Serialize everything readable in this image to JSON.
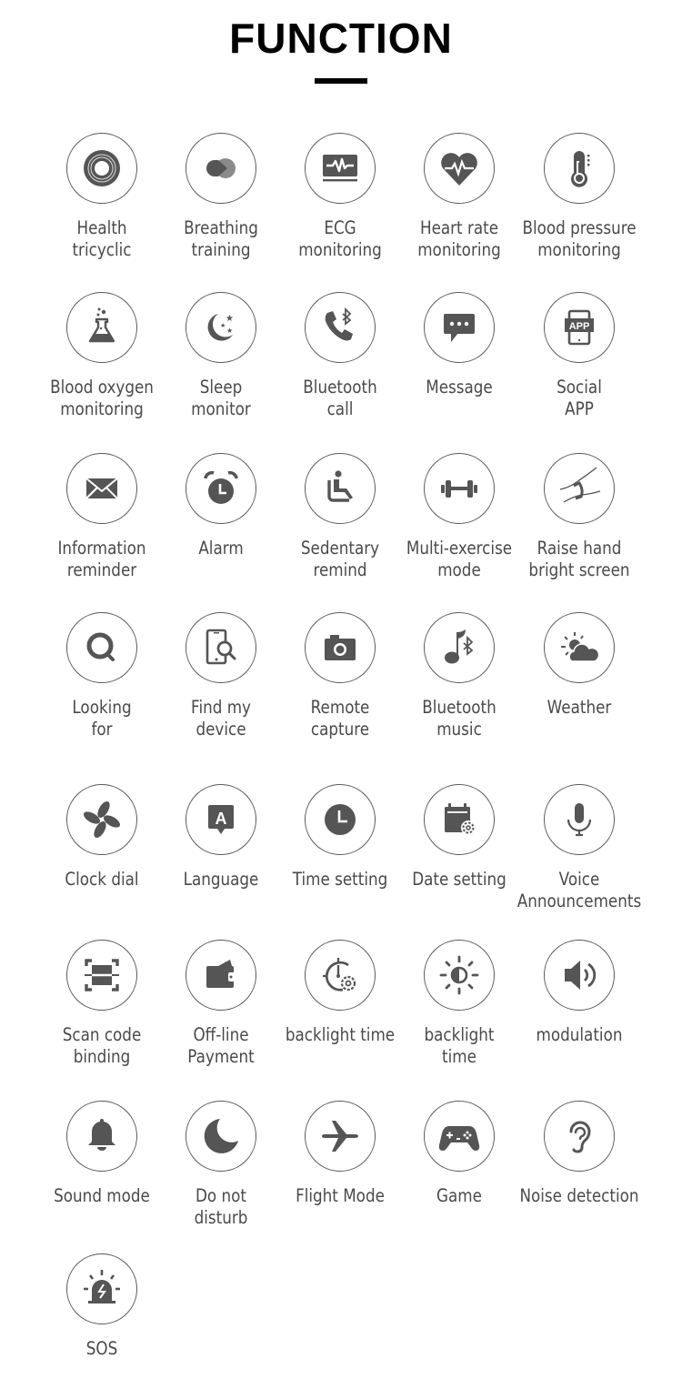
{
  "header": {
    "title": "FUNCTION"
  },
  "icon_color": "#555555",
  "features": [
    {
      "id": "health-tricyclic",
      "icon": "concentric-rings-icon",
      "lines": [
        "Health",
        "tricyclic"
      ]
    },
    {
      "id": "breathing-training",
      "icon": "breathing-drops-icon",
      "lines": [
        "Breathing",
        "training"
      ]
    },
    {
      "id": "ecg-monitoring",
      "icon": "ecg-monitor-icon",
      "lines": [
        "ECG",
        "monitoring"
      ]
    },
    {
      "id": "heart-rate-monitoring",
      "icon": "heart-pulse-icon",
      "lines": [
        "Heart rate",
        "monitoring"
      ]
    },
    {
      "id": "blood-pressure-monitoring",
      "icon": "thermometer-icon",
      "lines": [
        "Blood pressure",
        "monitoring"
      ]
    },
    {
      "id": "blood-oxygen-monitoring",
      "icon": "flask-icon",
      "lines": [
        "Blood oxygen",
        "monitoring"
      ]
    },
    {
      "id": "sleep-monitor",
      "icon": "moon-stars-icon",
      "lines": [
        "Sleep",
        "monitor"
      ]
    },
    {
      "id": "bluetooth-call",
      "icon": "phone-bluetooth-icon",
      "lines": [
        "Bluetooth",
        "call"
      ]
    },
    {
      "id": "message",
      "icon": "chat-bubble-icon",
      "lines": [
        "Message"
      ]
    },
    {
      "id": "social-app",
      "icon": "app-tablet-icon",
      "lines": [
        "Social",
        "APP"
      ]
    },
    {
      "id": "information-reminder",
      "icon": "envelope-icon",
      "lines": [
        "Information",
        "reminder"
      ]
    },
    {
      "id": "alarm",
      "icon": "alarm-clock-icon",
      "lines": [
        "Alarm"
      ]
    },
    {
      "id": "sedentary-remind",
      "icon": "seated-person-icon",
      "lines": [
        "Sedentary",
        "remind"
      ]
    },
    {
      "id": "multi-exercise-mode",
      "icon": "dumbbell-icon",
      "lines": [
        "Multi-exercise",
        "mode"
      ]
    },
    {
      "id": "raise-hand-bright-screen",
      "icon": "wrist-band-icon",
      "lines": [
        "Raise hand",
        "bright screen"
      ]
    },
    {
      "id": "looking-for",
      "icon": "search-icon",
      "lines": [
        "Looking",
        "for"
      ]
    },
    {
      "id": "find-my-device",
      "icon": "phone-search-icon",
      "lines": [
        "Find my",
        "device"
      ]
    },
    {
      "id": "remote-capture",
      "icon": "camera-icon",
      "lines": [
        "Remote",
        "capture"
      ]
    },
    {
      "id": "bluetooth-music",
      "icon": "music-bluetooth-icon",
      "lines": [
        "Bluetooth",
        "music"
      ]
    },
    {
      "id": "weather",
      "icon": "sun-cloud-icon",
      "lines": [
        "Weather"
      ]
    },
    {
      "id": "clock-dial",
      "icon": "pinwheel-icon",
      "lines": [
        "Clock dial"
      ]
    },
    {
      "id": "language",
      "icon": "language-bubble-icon",
      "lines": [
        "Language"
      ]
    },
    {
      "id": "time-setting",
      "icon": "clock-icon",
      "lines": [
        "Time setting"
      ]
    },
    {
      "id": "date-setting",
      "icon": "calendar-gear-icon",
      "lines": [
        "Date setting"
      ]
    },
    {
      "id": "voice-announcements",
      "icon": "microphone-icon",
      "lines": [
        "Voice",
        "Announcements"
      ]
    },
    {
      "id": "scan-code-binding",
      "icon": "scan-frame-icon",
      "lines": [
        "Scan code",
        "binding"
      ]
    },
    {
      "id": "off-line-payment",
      "icon": "wallet-icon",
      "lines": [
        "Off-line",
        "Payment"
      ]
    },
    {
      "id": "backlight-time-1",
      "icon": "timer-gear-icon",
      "lines": [
        "backlight time"
      ]
    },
    {
      "id": "backlight-time-2",
      "icon": "brightness-icon",
      "lines": [
        "backlight",
        "time"
      ]
    },
    {
      "id": "modulation",
      "icon": "speaker-icon",
      "lines": [
        "modulation"
      ]
    },
    {
      "id": "sound-mode",
      "icon": "bell-icon",
      "lines": [
        "Sound mode"
      ]
    },
    {
      "id": "do-not-disturb",
      "icon": "crescent-moon-icon",
      "lines": [
        "Do not",
        "disturb"
      ]
    },
    {
      "id": "flight-mode",
      "icon": "airplane-icon",
      "lines": [
        "Flight Mode"
      ]
    },
    {
      "id": "game",
      "icon": "gamepad-icon",
      "lines": [
        "Game"
      ]
    },
    {
      "id": "noise-detection",
      "icon": "ear-icon",
      "lines": [
        "Noise detection"
      ]
    },
    {
      "id": "sos",
      "icon": "siren-icon",
      "lines": [
        "SOS"
      ]
    }
  ]
}
